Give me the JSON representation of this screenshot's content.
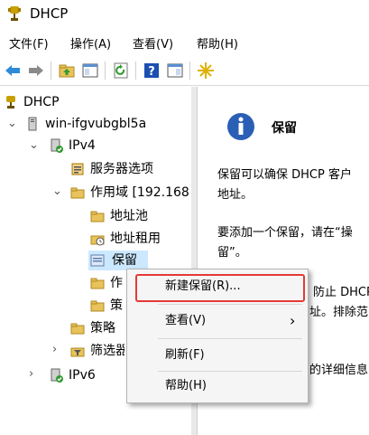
{
  "window": {
    "title": "DHCP"
  },
  "menubar": {
    "file": "文件(F)",
    "action": "操作(A)",
    "view": "查看(V)",
    "help": "帮助(H)"
  },
  "toolbar": {
    "icons": [
      "back-arrow-icon",
      "forward-arrow-icon",
      "up-folder-icon",
      "show-hide-tree-icon",
      "refresh-icon",
      "help-icon",
      "properties-icon",
      "new-sparkle-icon"
    ]
  },
  "tree": {
    "root": "DHCP",
    "server": "win-ifgvubgbl5a",
    "ipv4": "IPv4",
    "server_options": "服务器选项",
    "scope": "作用域 [192.168",
    "address_pool": "地址池",
    "address_leases": "地址租用",
    "reservations": "保留",
    "scope_options_partial": "作",
    "policies_partial": "策",
    "policies": "策略",
    "filters": "筛选器",
    "ipv6": "IPv6"
  },
  "detail": {
    "title": "保留",
    "line1": "保留可以确保 DHCP 客户",
    "line2": "地址。",
    "line3": "要添加一个保留，请在“操",
    "line4": "留”。",
    "line5": "防止 DHCP",
    "line6": "址。排除范",
    "line7": "的详细信息"
  },
  "context_menu": {
    "new_reservation": "新建保留(R)...",
    "view": "查看(V)",
    "view_arrow": "›",
    "refresh": "刷新(F)",
    "help": "帮助(H)"
  },
  "colors": {
    "highlight_border": "#e53935",
    "selection": "#cce8ff"
  }
}
